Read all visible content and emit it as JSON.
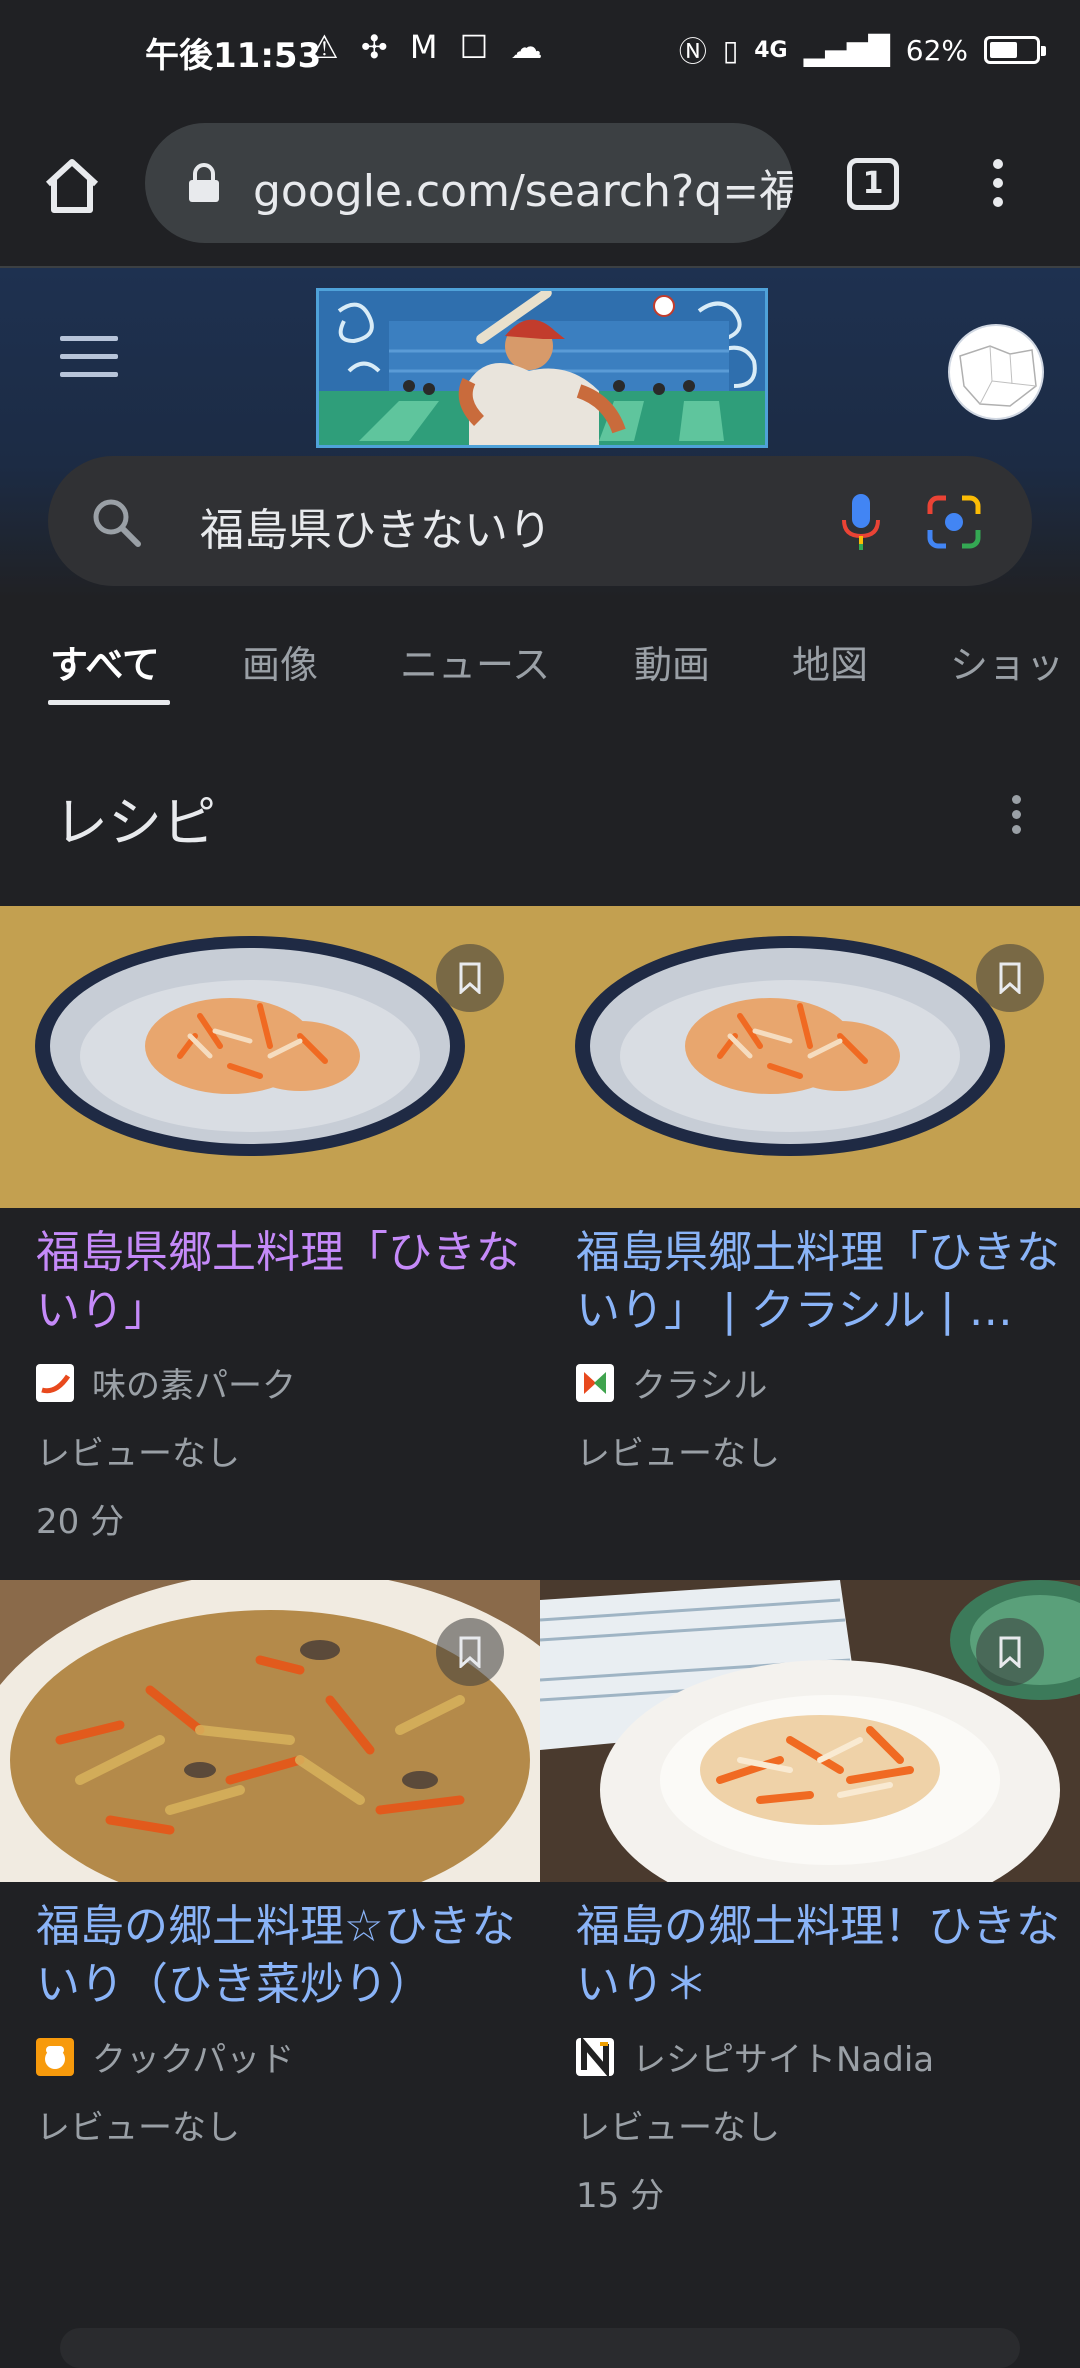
{
  "status": {
    "time": "午後11:53",
    "left_icons": "⚠ ✣ M ☐ ☁",
    "network": "4G",
    "battery": "62%",
    "battery_level": 0.62
  },
  "browser": {
    "url": "google.com/search?q=福",
    "tab_count": "1"
  },
  "search": {
    "query": "福島県ひきないり"
  },
  "tabs": [
    "すべて",
    "画像",
    "ニュース",
    "動画",
    "地図",
    "ショッ"
  ],
  "section": {
    "title": "レシピ"
  },
  "recipes": [
    {
      "title": "福島県郷土料理「ひきないり」",
      "source": "味の素パーク",
      "review": "レビューなし",
      "time": "20 分",
      "visited": true
    },
    {
      "title": "福島県郷土料理「ひきないり」 | クラシル | …",
      "source": "クラシル",
      "review": "レビューなし",
      "time": "",
      "visited": false
    },
    {
      "title": "福島の郷土料理☆ひきないり（ひき菜炒り）",
      "source": "クックパッド",
      "review": "レビューなし",
      "time": "",
      "visited": false
    },
    {
      "title": "福島の郷土料理！ひきないり＊",
      "source": "レシピサイトNadia",
      "review": "レビューなし",
      "time": "15 分",
      "visited": false
    }
  ],
  "colors": {
    "background": "#202124",
    "link": "#8ab4f8",
    "visited_link": "#c58af9",
    "secondary_text": "#9aa0a6"
  }
}
